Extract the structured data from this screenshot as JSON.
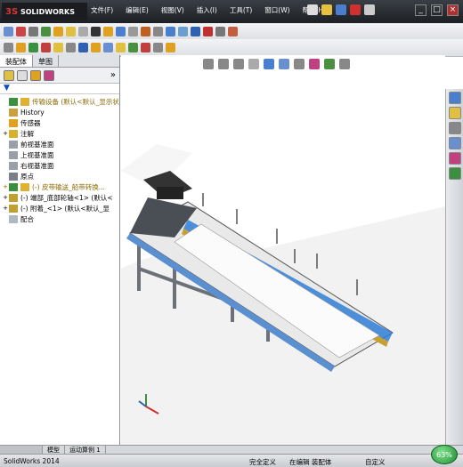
{
  "app": {
    "logo_text": "SOLIDWORKS",
    "logo_prefix": "3S"
  },
  "menu": [
    "文件(F)",
    "编辑(E)",
    "视图(V)",
    "插入(I)",
    "工具(T)",
    "窗口(W)",
    "帮助(H)"
  ],
  "panel": {
    "tabs": [
      "装配体",
      "草图"
    ],
    "filter_symbol": "▼",
    "collapse_symbol": "»",
    "tree": [
      {
        "label": "传输设备  (默认<默认_显示状",
        "expander": "",
        "icon_color": "#e0b030",
        "warn": true,
        "indent": 0
      },
      {
        "label": "History",
        "expander": "",
        "icon_color": "#c8a040",
        "indent": 1
      },
      {
        "label": "传感器",
        "expander": "",
        "icon_color": "#e0a020",
        "indent": 1
      },
      {
        "label": "注解",
        "expander": "+",
        "icon_color": "#d8b030",
        "indent": 1
      },
      {
        "label": "前视基准面",
        "expander": "",
        "icon_color": "#9aa0a8",
        "indent": 1
      },
      {
        "label": "上视基准面",
        "expander": "",
        "icon_color": "#9aa0a8",
        "indent": 1
      },
      {
        "label": "右视基准面",
        "expander": "",
        "icon_color": "#9aa0a8",
        "indent": 1
      },
      {
        "label": "原点",
        "expander": "",
        "icon_color": "#7a8088",
        "indent": 1
      },
      {
        "label": "(-) 皮带输送_船带转换...",
        "expander": "+",
        "icon_color": "#e0b030",
        "warn": true,
        "indent": 1
      },
      {
        "label": "(-) 端部_底部轮轴<1> (默认<",
        "expander": "+",
        "icon_color": "#c0a030",
        "indent": 1
      },
      {
        "label": "(-) 附着_<1> (默认<默认_显",
        "expander": "+",
        "icon_color": "#c0a030",
        "indent": 1
      },
      {
        "label": "配合",
        "expander": "",
        "icon_color": "#b0b8c0",
        "indent": 1
      }
    ]
  },
  "bottom_tabs": [
    "模型",
    "运动算例 1"
  ],
  "status": {
    "app_name": "SolidWorks 2014",
    "definition": "完全定义",
    "editing": "在编辑 装配体",
    "custom": "自定义"
  },
  "zoom_badge": "63%"
}
